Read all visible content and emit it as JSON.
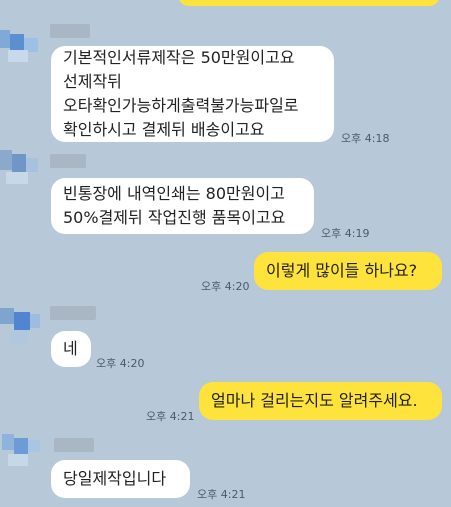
{
  "messages": [
    {
      "id": "m1",
      "side": "in",
      "text": "기본적인서류제작은 50만원이고요\n선제작뒤\n오타확인가능하게출력불가능파일로\n확인하시고 결제뒤 배송이고요",
      "time": "오후 4:18"
    },
    {
      "id": "m2",
      "side": "in",
      "text": "빈통장에 내역인쇄는 80만원이고\n50%결제뒤 작업진행 품목이고요",
      "time": "오후 4:19"
    },
    {
      "id": "m3",
      "side": "out",
      "text": "이렇게 많이들 하나요?",
      "time": "오후 4:20"
    },
    {
      "id": "m4",
      "side": "in",
      "text": "네",
      "time": "오후 4:20"
    },
    {
      "id": "m5",
      "side": "out",
      "text": "얼마나 걸리는지도 알려주세요.",
      "time": "오후 4:21"
    },
    {
      "id": "m6",
      "side": "in",
      "text": "당일제작입니다",
      "time": "오후 4:21"
    }
  ],
  "colors": {
    "background": "#b7c9d9",
    "incoming_bubble": "#ffffff",
    "outgoing_bubble": "#fde33b"
  }
}
